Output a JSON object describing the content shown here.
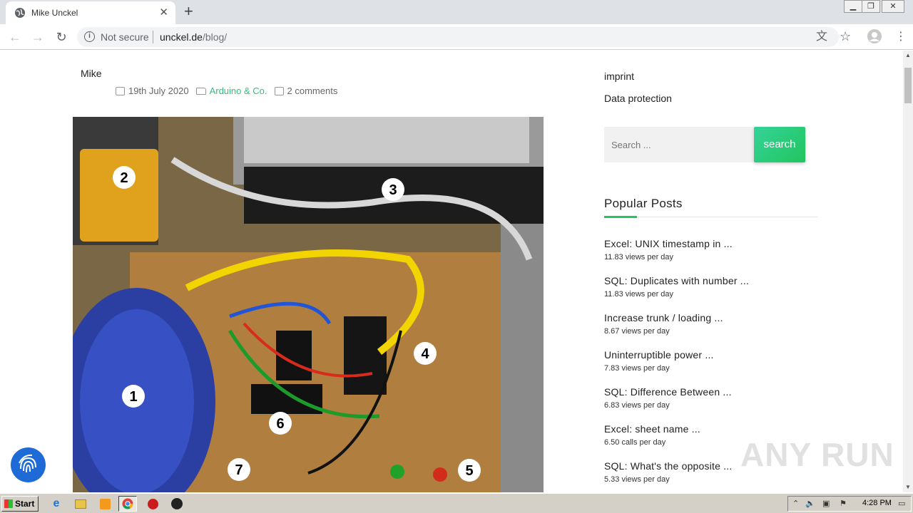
{
  "browser": {
    "tab_title": "Mike Unckel",
    "security_label": "Not secure",
    "url_domain": "unckel.de",
    "url_path": "/blog/"
  },
  "post": {
    "author": "Mike",
    "date": "19th July 2020",
    "category": "Arduino & Co.",
    "comments": "2 comments",
    "photo_labels": [
      "1",
      "2",
      "3",
      "4",
      "5",
      "6",
      "7"
    ]
  },
  "sidebar": {
    "links": [
      "imprint",
      "Data protection"
    ],
    "search_placeholder": "Search ...",
    "search_button": "search",
    "widget_title": "Popular Posts",
    "popular_posts": [
      {
        "title": "Excel: UNIX timestamp in ...",
        "views": "11.83 views per day"
      },
      {
        "title": "SQL: Duplicates with number ...",
        "views": "11.83 views per day"
      },
      {
        "title": "Increase trunk / loading ...",
        "views": "8.67 views per day"
      },
      {
        "title": "Uninterruptible power ...",
        "views": "7.83 views per day"
      },
      {
        "title": "SQL: Difference Between ...",
        "views": "6.83 views per day"
      },
      {
        "title": "Excel: sheet name ...",
        "views": "6.50 calls per day"
      },
      {
        "title": "SQL: What's the opposite ...",
        "views": "5.33 views per day"
      }
    ]
  },
  "watermark": "ANY RUN",
  "taskbar": {
    "start_label": "Start",
    "clock": "4:28 PM"
  },
  "colors": {
    "accent_green": "#22c55e",
    "category_green": "#2ec27e",
    "fab_blue": "#1e6ad6"
  }
}
